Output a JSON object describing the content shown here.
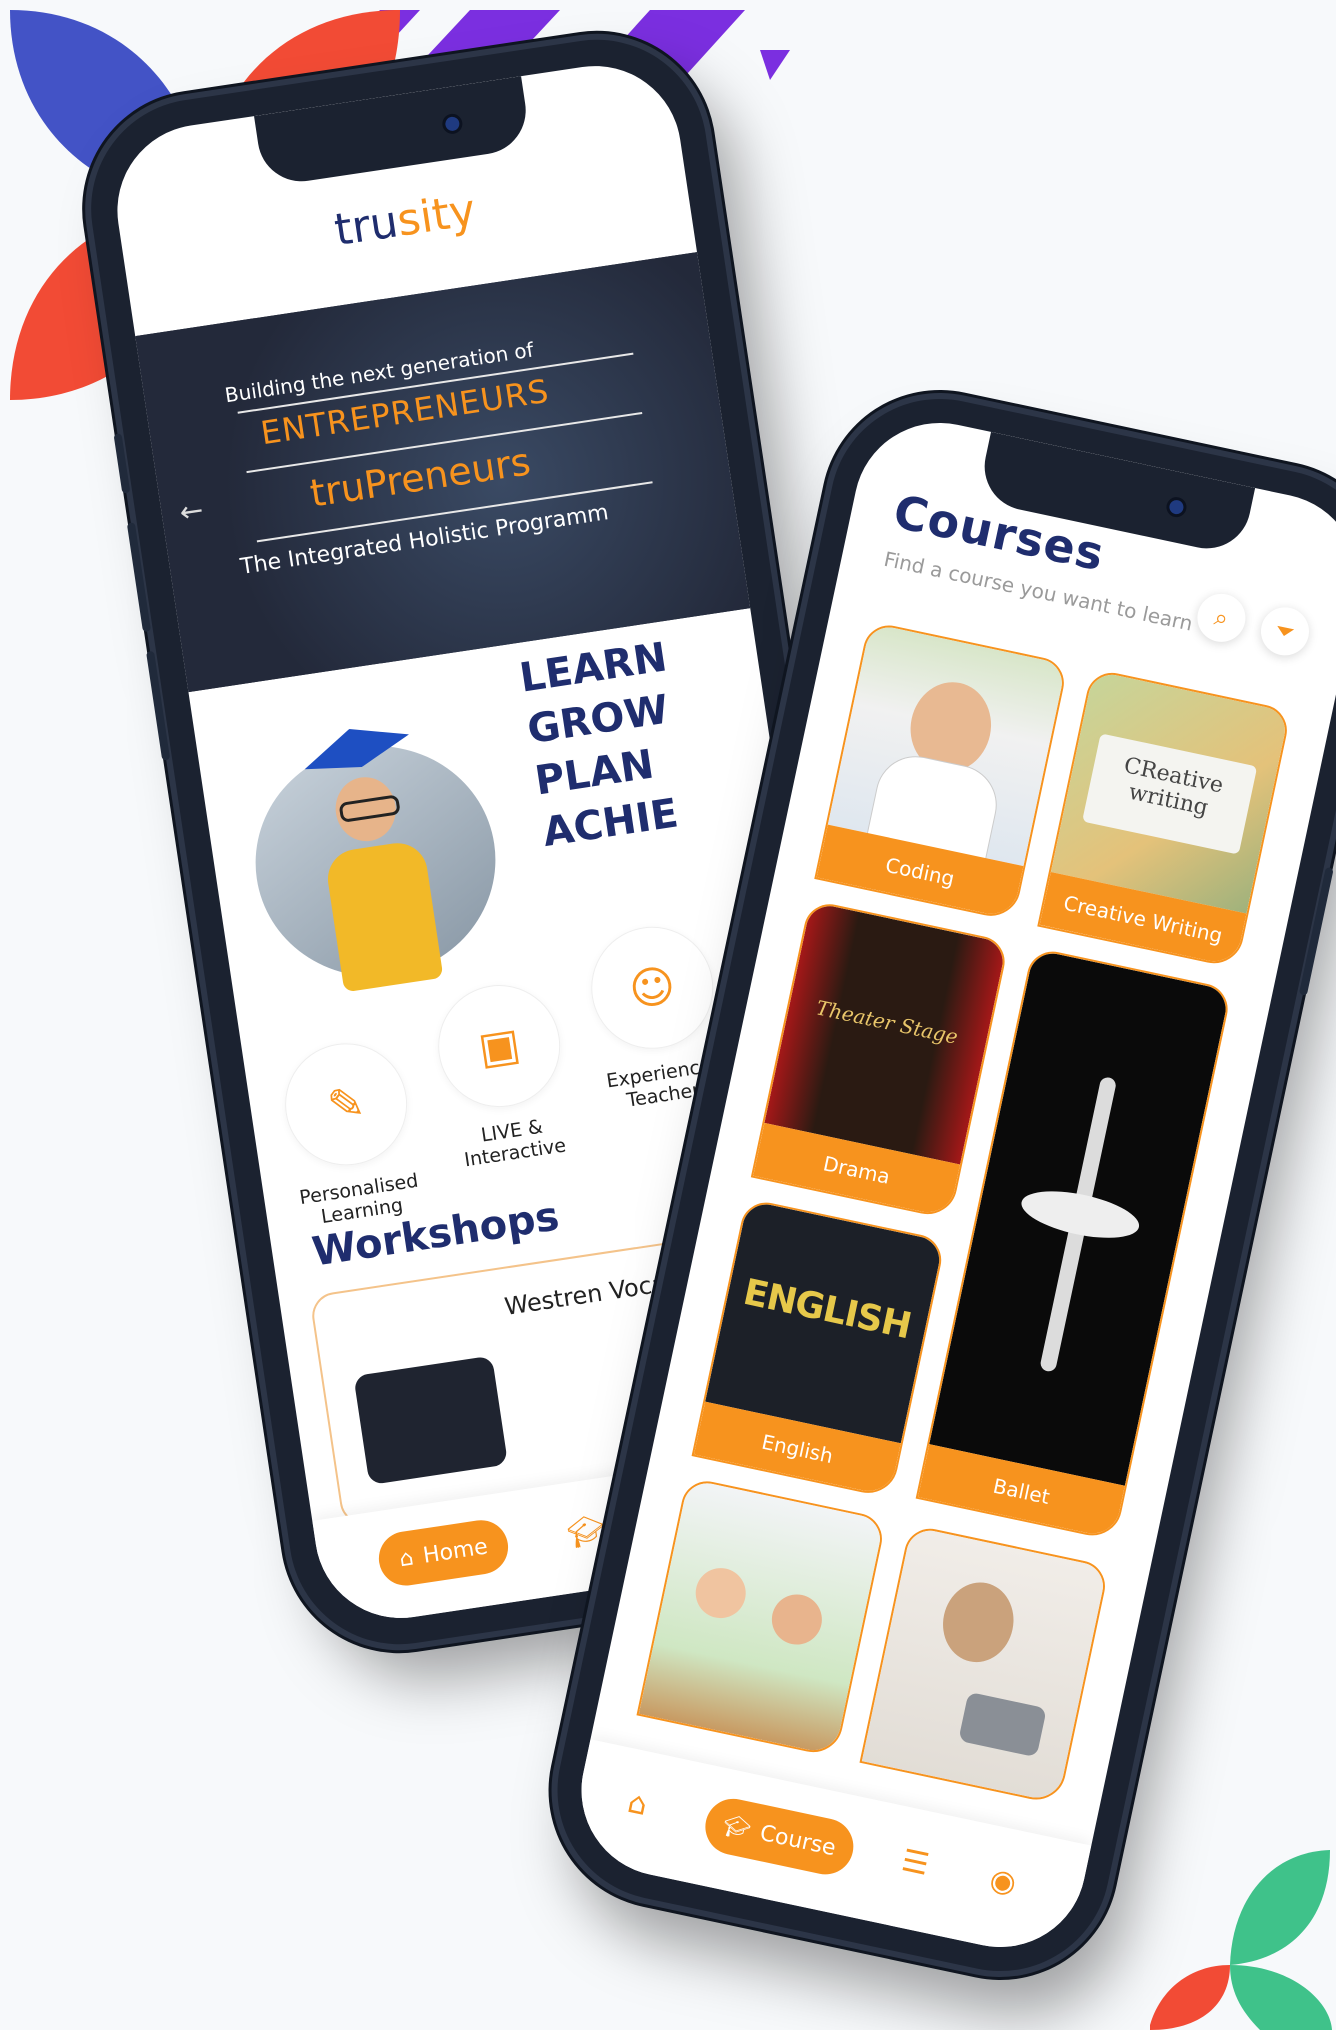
{
  "colors": {
    "accent": "#f7931e",
    "navy": "#1f2d6e",
    "petal_blue": "#4353c6",
    "petal_red": "#f24b35",
    "stripe_purple": "#7b2fe0",
    "stripe_yellow": "#ffb400",
    "petal_green": "#3fc28a"
  },
  "home": {
    "logo_prefix": "tru",
    "logo_accent": "sity",
    "hero": {
      "line1": "Building the next generation of",
      "line2": "ENTREPRENEURS",
      "line3": "truPreneurs",
      "line4": "The Integrated Holistic Programm",
      "prev_icon": "arrow-left-icon"
    },
    "slogan": [
      "LEARN",
      "GROW",
      "PLAN",
      "ACHIE"
    ],
    "features": [
      {
        "label": "Personalised Learning",
        "icon": "learner-desk-icon"
      },
      {
        "label": "LIVE & Interactive",
        "icon": "live-screen-icon"
      },
      {
        "label": "Experienced Teachers",
        "icon": "teacher-icon"
      }
    ],
    "workshops_title": "Workshops",
    "workshop_name": "Westren Vocals",
    "nav": {
      "home_label": "Home"
    }
  },
  "courses": {
    "title": "Courses",
    "subtitle": "Find a course you want to learn",
    "items": [
      {
        "label": "Coding"
      },
      {
        "label": "Creative Writing",
        "image_text": "CReative writing"
      },
      {
        "label": "Drama",
        "image_text": "Theater Stage"
      },
      {
        "label": "Ballet"
      },
      {
        "label": "English",
        "image_text": "ENGLISH"
      },
      {
        "label": ""
      },
      {
        "label": ""
      }
    ],
    "nav": {
      "course_label": "Course"
    }
  }
}
